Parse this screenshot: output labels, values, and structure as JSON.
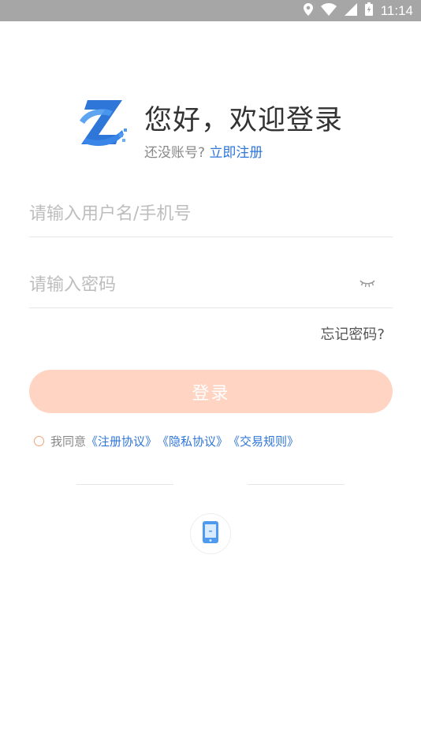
{
  "status_bar": {
    "time": "11:14",
    "icons": [
      "location-icon",
      "wifi-icon",
      "signal-icon",
      "battery-icon"
    ]
  },
  "header": {
    "greeting": "您好，欢迎登录",
    "no_account": "还没账号?",
    "register_link": "立即注册"
  },
  "form": {
    "username_placeholder": "请输入用户名/手机号",
    "password_placeholder": "请输入密码",
    "forgot_password": "忘记密码?",
    "login_button": "登录"
  },
  "agreement": {
    "prefix": "我同意",
    "register_agreement": "《注册协议》",
    "privacy_agreement": "《隐私协议》",
    "trading_rules": "《交易规则》"
  },
  "colors": {
    "accent": "#2f76d9",
    "login_button_bg": "#ffd4c3",
    "statusbar": "#a6a6a6"
  }
}
